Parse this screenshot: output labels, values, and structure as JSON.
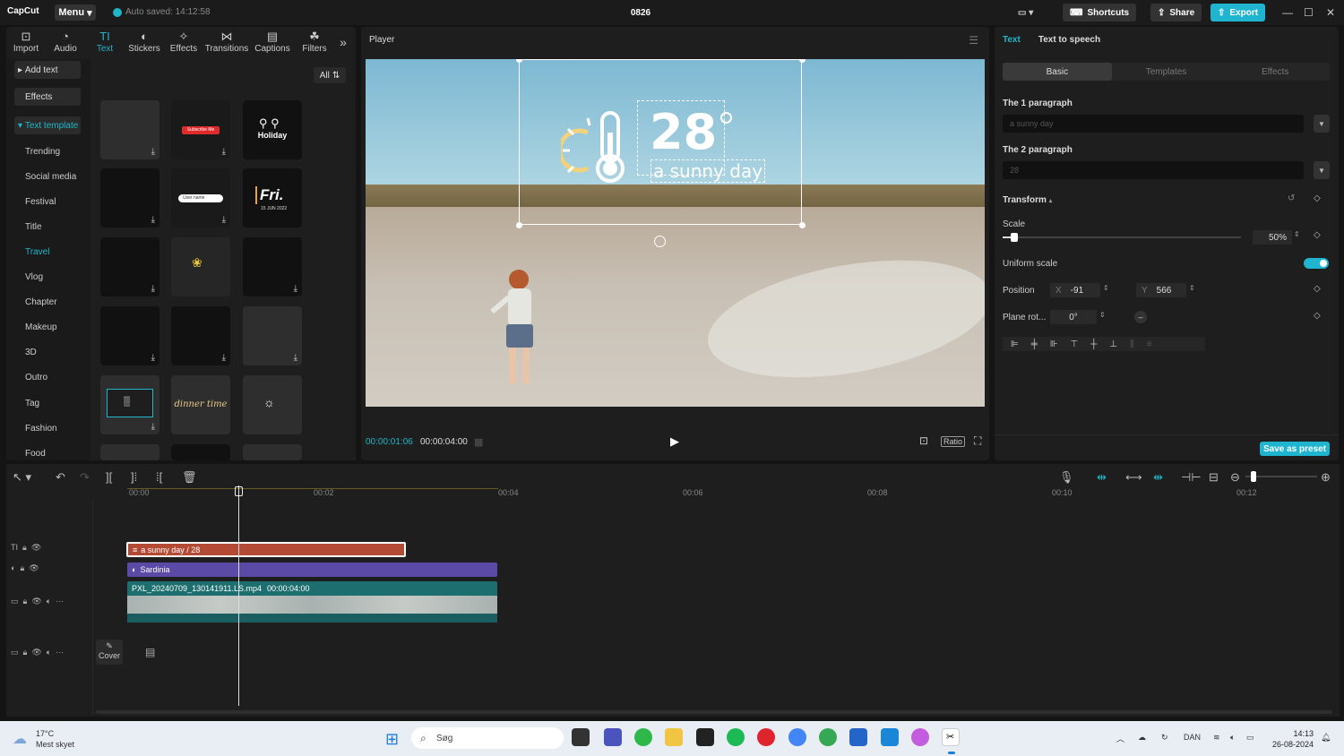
{
  "app": {
    "logo": "CapCut",
    "menu_label": "Menu",
    "autosave": "Auto saved: 14:12:58",
    "project_title": "0826",
    "shortcuts": "Shortcuts",
    "share": "Share",
    "export": "Export"
  },
  "toolbar": [
    {
      "label": "Import",
      "icon": "import-icon"
    },
    {
      "label": "Audio",
      "icon": "audio-icon"
    },
    {
      "label": "Text",
      "icon": "text-icon",
      "active": true
    },
    {
      "label": "Stickers",
      "icon": "stickers-icon"
    },
    {
      "label": "Effects",
      "icon": "effects-icon"
    },
    {
      "label": "Transitions",
      "icon": "transitions-icon"
    },
    {
      "label": "Captions",
      "icon": "captions-icon"
    },
    {
      "label": "Filters",
      "icon": "filters-icon"
    }
  ],
  "sidebar": {
    "add_text": "Add text",
    "effects": "Effects",
    "text_template": "Text template",
    "categories": [
      "Trending",
      "Social media",
      "Festival",
      "Title",
      "Travel",
      "Vlog",
      "Chapter",
      "Makeup",
      "3D",
      "Outro",
      "Tag",
      "Fashion",
      "Food"
    ],
    "active_category": "Travel"
  },
  "templates": {
    "filter_label": "All",
    "tiles": [
      {
        "label": ""
      },
      {
        "label": "Subscribe Me"
      },
      {
        "label": "Holiday"
      },
      {
        "label": ""
      },
      {
        "label": "User name"
      },
      {
        "label": "Fri."
      },
      {
        "label": ""
      },
      {
        "label": ""
      },
      {
        "label": ""
      },
      {
        "label": ""
      },
      {
        "label": ""
      },
      {
        "label": ""
      },
      {
        "label": ""
      },
      {
        "label": "dinner time"
      },
      {
        "label": ""
      }
    ],
    "fri_date": "15 JUN 2022"
  },
  "player": {
    "title": "Player",
    "overlay_temp": "28",
    "overlay_text": "a sunny day",
    "current_time": "00:00:01:06",
    "total_time": "00:00:04:00",
    "ratio": "Ratio"
  },
  "inspector": {
    "tabs": [
      "Text",
      "Text to speech"
    ],
    "subtabs": [
      "Basic",
      "Templates",
      "Effects"
    ],
    "paragraph1_label": "The 1 paragraph",
    "paragraph1_value": "a sunny day",
    "paragraph2_label": "The 2 paragraph",
    "paragraph2_value": "28",
    "transform": "Transform",
    "scale_label": "Scale",
    "scale_value": "50%",
    "scale_fraction": 0.05,
    "uniform_scale": "Uniform scale",
    "position_label": "Position",
    "pos_x_label": "X",
    "pos_x": "-91",
    "pos_y_label": "Y",
    "pos_y": "566",
    "rotation_label": "Plane rot...",
    "rotation": "0°",
    "save_preset": "Save as preset"
  },
  "timeline": {
    "ruler": [
      "00:00",
      "00:02",
      "00:04",
      "00:06",
      "00:08",
      "00:10",
      "00:12"
    ],
    "text_clip": "a sunny day / 28",
    "sticker_clip": "Sardinia",
    "video_clip": "PXL_20240709_130141911.LS.mp4",
    "video_duration": "00:00:04:00",
    "cover": "Cover"
  },
  "taskbar": {
    "temp": "17°C",
    "weather": "Mest skyet",
    "search": "Søg",
    "lang": "DAN",
    "time": "14:13",
    "date": "26-08-2024"
  },
  "colors": {
    "accent": "#21b5c8",
    "text_clip": "#b34a36",
    "sticker_clip": "#5b4aa6",
    "video_clip": "#1d6e6e"
  }
}
